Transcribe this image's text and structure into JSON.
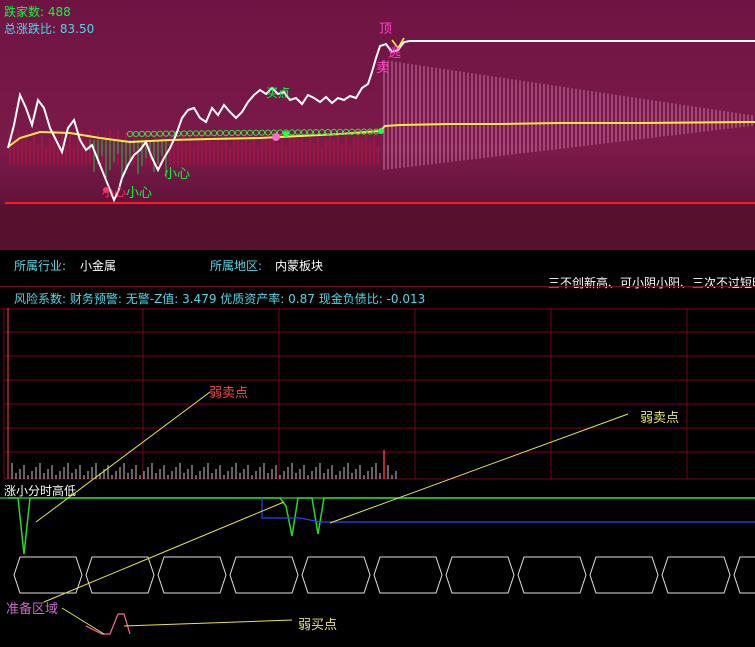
{
  "header": {
    "decline_label": "跌家数:",
    "decline_value": "488",
    "ratio_label": "总涨跌比:",
    "ratio_value": "83.50"
  },
  "top_annotations": {
    "top": "顶",
    "sell_line1": "逃",
    "sell_line2": "卖",
    "caution_a": "小心",
    "caution_b": "小心",
    "caution_c": "小心",
    "green_tag": "买点"
  },
  "info": {
    "industry_label": "所属行业:",
    "industry_value": "小金属",
    "region_label": "所属地区:",
    "region_value": "内蒙板块",
    "scroll_text": "三不创新高、可小阴小阳、三次不过短时",
    "risk_label": "风险系数:",
    "risk_text": "财务预警: 无警-Z值: 3.479 优质资产率: 0.87 现金负债比: -0.013"
  },
  "lower_annotations": {
    "weak_sell_1": "弱卖点",
    "weak_sell_2": "弱卖点",
    "indicator_title": "涨小分时高低",
    "prepare_zone": "准备区域",
    "weak_buy": "弱买点"
  },
  "colors": {
    "top_bg": "#7a1848",
    "green_text": "#00ff40",
    "cyan_text": "#4fd8e8",
    "yellow": "#ffff33",
    "magenta": "#ff44cc",
    "grid_red": "#8a0018"
  }
}
